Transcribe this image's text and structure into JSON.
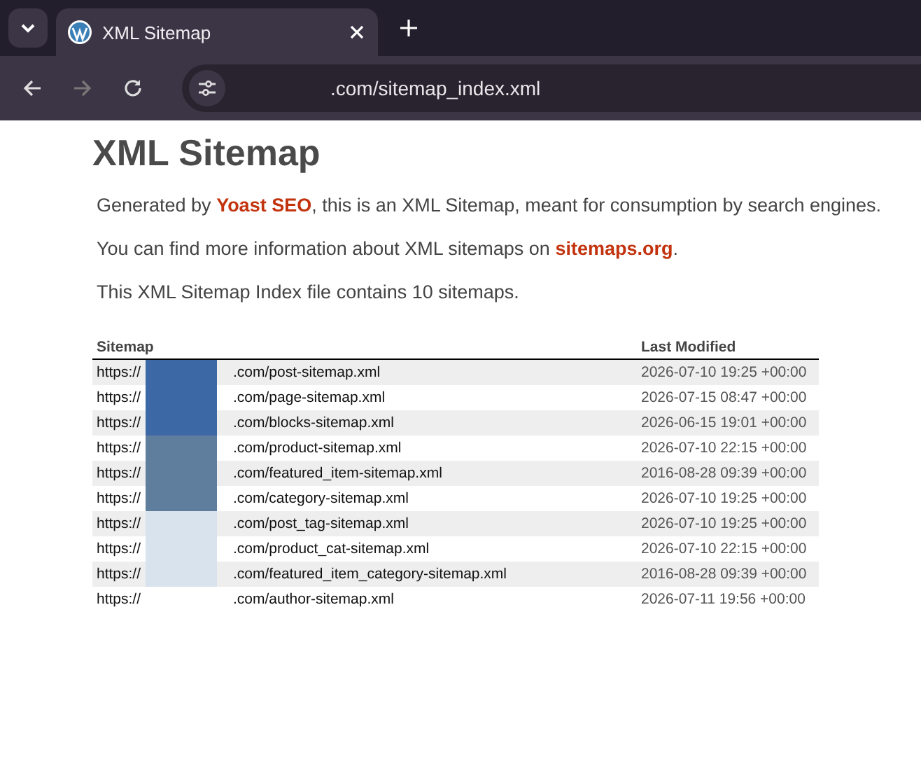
{
  "browser": {
    "tab": {
      "title": "XML Sitemap"
    },
    "address": ".com/sitemap_index.xml"
  },
  "page": {
    "title": "XML Sitemap",
    "paragraphs": [
      "Generated by **Yoast SEO**, this is an XML Sitemap, meant for consumption by search engines.",
      "You can find more information about XML sitemaps on **sitemaps.org**.",
      "This XML Sitemap Index file contains 10 sitemaps."
    ],
    "table": {
      "columns": [
        "Sitemap",
        "Last Modified"
      ],
      "rows": [
        {
          "url_start": "https://",
          "url_end": ".com/post-sitemap.xml",
          "modified": "2026-07-10 19:25 +00:00"
        },
        {
          "url_start": "https://",
          "url_end": ".com/page-sitemap.xml",
          "modified": "2026-07-15 08:47 +00:00"
        },
        {
          "url_start": "https://",
          "url_end": ".com/blocks-sitemap.xml",
          "modified": "2026-06-15 19:01 +00:00"
        },
        {
          "url_start": "https://",
          "url_end": ".com/product-sitemap.xml",
          "modified": "2026-07-10 22:15 +00:00"
        },
        {
          "url_start": "https://",
          "url_end": ".com/featured_item-sitemap.xml",
          "modified": "2016-08-28 09:39 +00:00"
        },
        {
          "url_start": "https://",
          "url_end": ".com/category-sitemap.xml",
          "modified": "2026-07-10 19:25 +00:00"
        },
        {
          "url_start": "https://",
          "url_end": ".com/post_tag-sitemap.xml",
          "modified": "2026-07-10 19:25 +00:00"
        },
        {
          "url_start": "https://",
          "url_end": ".com/product_cat-sitemap.xml",
          "modified": "2026-07-10 22:15 +00:00"
        },
        {
          "url_start": "https://",
          "url_end": ".com/featured_item_category-sitemap.xml",
          "modified": "2016-08-28 09:39 +00:00"
        },
        {
          "url_start": "https://",
          "url_end": ".com/author-sitemap.xml",
          "modified": "2026-07-11 19:56 +00:00"
        }
      ]
    }
  }
}
